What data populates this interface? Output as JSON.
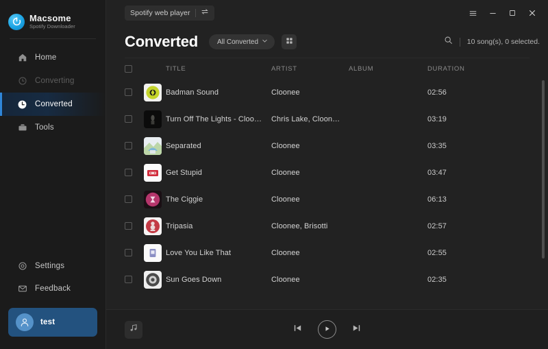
{
  "brand": {
    "name": "Macsome",
    "subtitle": "Spotify Downloader",
    "logo_icon": "macsome-logo-icon",
    "accent": "#1ba3e3"
  },
  "sidebar": {
    "items": [
      {
        "label": "Home",
        "icon": "home-icon",
        "state": "normal"
      },
      {
        "label": "Converting",
        "icon": "refresh-icon",
        "state": "disabled"
      },
      {
        "label": "Converted",
        "icon": "clock-icon",
        "state": "active"
      },
      {
        "label": "Tools",
        "icon": "toolbox-icon",
        "state": "normal"
      }
    ],
    "bottom_items": [
      {
        "label": "Settings",
        "icon": "gear-icon"
      },
      {
        "label": "Feedback",
        "icon": "mail-icon"
      }
    ],
    "user": {
      "name": "test",
      "avatar_icon": "user-avatar-icon",
      "card_color": "#23527f"
    },
    "active_accent": "#2f86d8"
  },
  "titlebar": {
    "source_button": "Spotify web player",
    "swap_icon": "swap-arrows-icon",
    "menu_icon": "hamburger-menu-icon",
    "minimize_icon": "minimize-icon",
    "maximize_icon": "maximize-icon",
    "close_icon": "close-icon"
  },
  "header": {
    "title": "Converted",
    "filter_value": "All Converted",
    "filter_chevron_icon": "chevron-down-icon",
    "grid_view_icon": "grid-view-icon",
    "search_icon": "search-icon",
    "song_count": "10 song(s), 0 selected."
  },
  "table": {
    "columns": [
      "TITLE",
      "ARTIST",
      "ALBUM",
      "DURATION"
    ],
    "select_all_checked": false,
    "rows": [
      {
        "title": "Badman Sound",
        "artist": "Cloonee",
        "album": "",
        "duration": "02:56",
        "checked": false,
        "cover": "badman-sound-cover"
      },
      {
        "title": "Turn Off The Lights - Cloone...",
        "artist": "Chris Lake, Cloonee,...",
        "album": "",
        "duration": "03:19",
        "checked": false,
        "cover": "turn-off-the-lights-cover"
      },
      {
        "title": "Separated",
        "artist": "Cloonee",
        "album": "",
        "duration": "03:35",
        "checked": false,
        "cover": "separated-cover"
      },
      {
        "title": "Get Stupid",
        "artist": "Cloonee",
        "album": "",
        "duration": "03:47",
        "checked": false,
        "cover": "get-stupid-cover"
      },
      {
        "title": "The Ciggie",
        "artist": "Cloonee",
        "album": "",
        "duration": "06:13",
        "checked": false,
        "cover": "the-ciggie-cover"
      },
      {
        "title": "Tripasia",
        "artist": "Cloonee, Brisotti",
        "album": "",
        "duration": "02:57",
        "checked": false,
        "cover": "tripasia-cover"
      },
      {
        "title": "Love You Like That",
        "artist": "Cloonee",
        "album": "",
        "duration": "02:55",
        "checked": false,
        "cover": "love-you-like-that-cover"
      },
      {
        "title": "Sun Goes Down",
        "artist": "Cloonee",
        "album": "",
        "duration": "02:35",
        "checked": false,
        "cover": "sun-goes-down-cover"
      }
    ]
  },
  "player": {
    "library_icon": "music-note-icon",
    "previous_icon": "previous-track-icon",
    "play_icon": "play-icon",
    "next_icon": "next-track-icon"
  }
}
